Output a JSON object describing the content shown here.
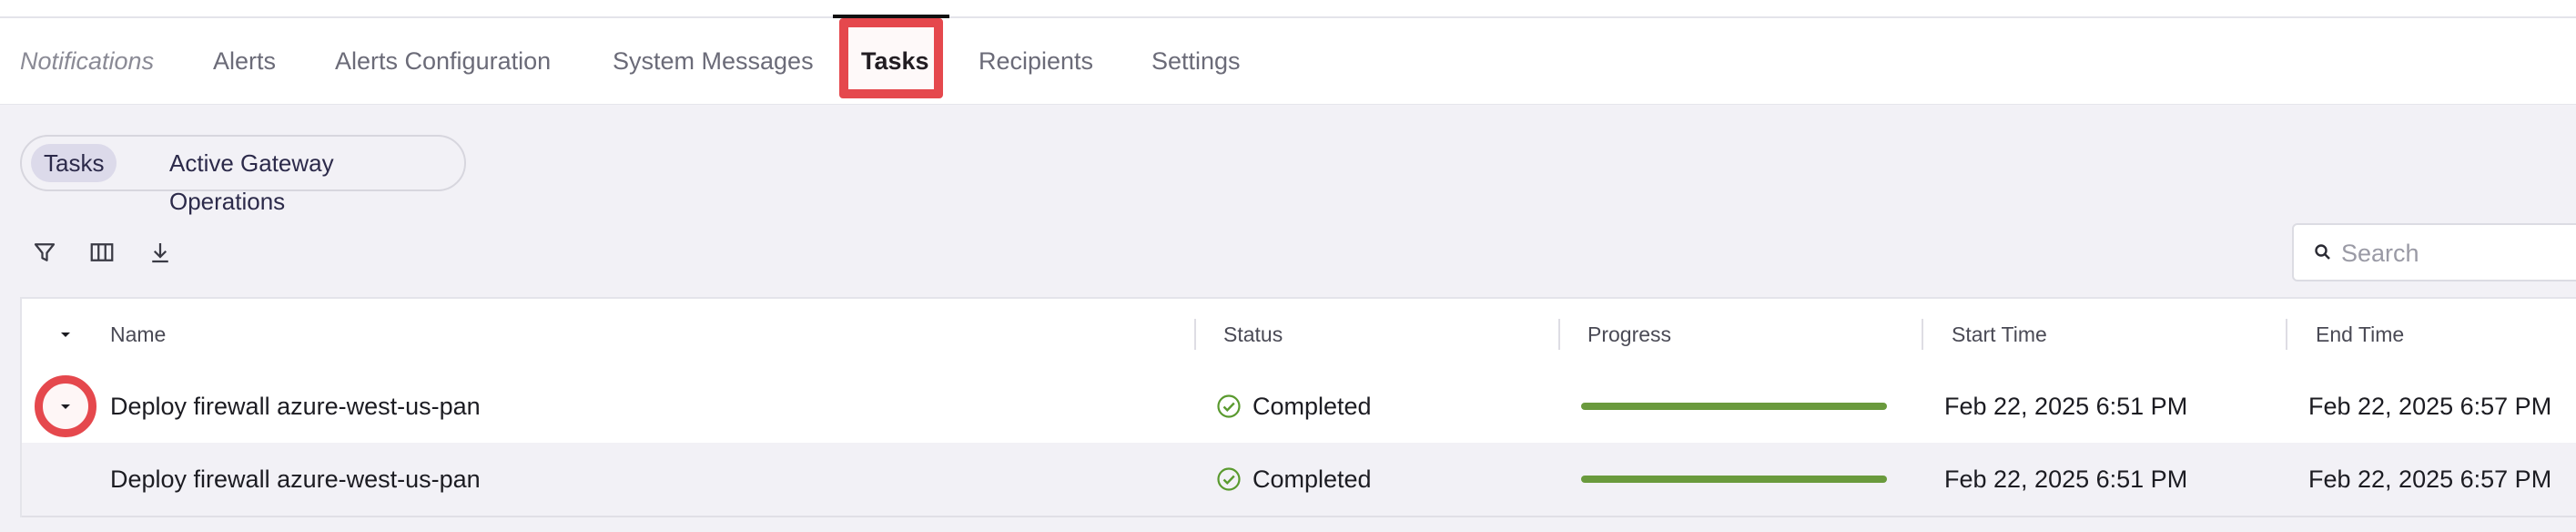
{
  "nav": {
    "section_label": "Notifications",
    "tabs": [
      {
        "label": "Alerts"
      },
      {
        "label": "Alerts Configuration"
      },
      {
        "label": "System Messages"
      },
      {
        "label": "Tasks",
        "active": true
      },
      {
        "label": "Recipients"
      },
      {
        "label": "Settings"
      }
    ]
  },
  "subtabs": [
    {
      "label": "Tasks",
      "active": true
    },
    {
      "label": "Active Gateway Operations"
    }
  ],
  "toolbar": {
    "icons": [
      "filter-icon",
      "columns-icon",
      "download-icon"
    ],
    "search_placeholder": "Search"
  },
  "table": {
    "columns": [
      "Name",
      "Status",
      "Progress",
      "Start Time",
      "End Time"
    ],
    "rows": [
      {
        "name": "Deploy firewall azure-west-us-pan",
        "status": "Completed",
        "progress": 1.0,
        "start": "Feb 22, 2025 6:51 PM",
        "end": "Feb 22, 2025 6:57 PM",
        "expandable": true
      },
      {
        "name": "Deploy firewall azure-west-us-pan",
        "status": "Completed",
        "progress": 1.0,
        "start": "Feb 22, 2025 6:51 PM",
        "end": "Feb 22, 2025 6:57 PM",
        "expandable": false
      }
    ]
  },
  "colors": {
    "accent_highlight": "#e5484d",
    "progress_complete": "#6a9a3d",
    "status_success": "#5a9a2f"
  }
}
